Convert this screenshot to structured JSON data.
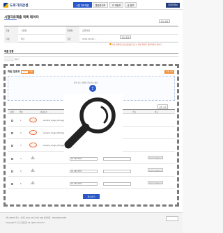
{
  "header": {
    "logo_text": "도로가유관센",
    "nav": [
      "시험 자료제출",
      "통합관리보",
      "교 재정보",
      "공 정보"
    ],
    "right_button": "민원인정보"
  },
  "page": {
    "title": "시험자료제출 목록 테이터",
    "info_rows": [
      {
        "label1": "구분",
        "value1": "시험명",
        "label2": "과정명",
        "value2": "교육과정"
      },
      {
        "label1": "시험",
        "value1": "제출",
        "label2": "기간",
        "value2": "2021.00.00 ~"
      }
    ],
    "change_button": "정보 변경",
    "notice": "사진 촬영자료 및 동영상은 반드시 원본 파일로 제출하셔야 합니다"
  },
  "section2": {
    "title": "제출 현황",
    "cell_value": "00 건"
  },
  "upload": {
    "frame_title": "파일 업로드",
    "btn_select": "선택",
    "btn_clear": "삭제",
    "btn_right": "전체 선택",
    "drop_text": "클릭 또는 파일을 끌어 놓으세요",
    "drop_text2": "파일 크기 제한 및 형식에 맞는 파일만 업로드 가능합니다",
    "right_small": "정렬 기준",
    "columns": [
      "선택",
      "번호",
      "미리보기",
      "파일명",
      "제목",
      "크기",
      "비고"
    ],
    "rows": [
      {
        "num": "1",
        "file": "sample_image_001.jpg",
        "has_thumb": true,
        "title": "",
        "note": ""
      },
      {
        "num": "2",
        "file": "sample_image_002.jpg",
        "has_thumb": true,
        "title": "",
        "note": ""
      },
      {
        "num": "3",
        "file": "sample_image_003.jpg",
        "has_thumb": true,
        "title": "",
        "note": ""
      },
      {
        "num": "4",
        "file": "",
        "has_thumb": false,
        "title": "12.345.678",
        "note": "확인이 필요합니다"
      },
      {
        "num": "5",
        "file": "",
        "has_thumb": false,
        "title": "12.345.678",
        "note": "확인이 필요합니다"
      },
      {
        "num": "6",
        "file": "",
        "has_thumb": false,
        "title": "12.345.678",
        "note": "확인이 필요합니다"
      }
    ],
    "submit_label": "제출하기"
  },
  "footer": {
    "line1": "(우) 00000 주소 : 경기도 00시 00구 00로 000 대표전화 : 000-0000-0000",
    "line2": "Copyright © 도로교통공단 All rights reserved."
  },
  "colors": {
    "primary": "#2a58c8",
    "accent": "#f28a2f",
    "brand_dark": "#1f3b7a"
  },
  "overlay_icon": "magnifier-icon"
}
